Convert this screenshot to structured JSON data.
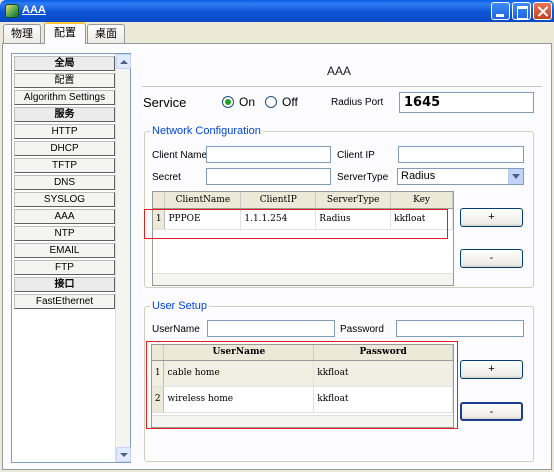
{
  "window": {
    "title": "AAA"
  },
  "tabs": [
    {
      "label": "物理"
    },
    {
      "label": "配置"
    },
    {
      "label": "桌面"
    }
  ],
  "sidebar": {
    "items": [
      {
        "label": "全局",
        "header": true
      },
      {
        "label": "配置",
        "header": false
      },
      {
        "label": "Algorithm Settings",
        "header": false
      },
      {
        "label": "服务",
        "header": true
      },
      {
        "label": "HTTP",
        "header": false
      },
      {
        "label": "DHCP",
        "header": false
      },
      {
        "label": "TFTP",
        "header": false
      },
      {
        "label": "DNS",
        "header": false
      },
      {
        "label": "SYSLOG",
        "header": false
      },
      {
        "label": "AAA",
        "header": false
      },
      {
        "label": "NTP",
        "header": false
      },
      {
        "label": "EMAIL",
        "header": false
      },
      {
        "label": "FTP",
        "header": false
      },
      {
        "label": "接口",
        "header": true
      },
      {
        "label": "FastEthernet",
        "header": false
      }
    ]
  },
  "main": {
    "section_title": "AAA",
    "service": {
      "label": "Service",
      "on_label": "On",
      "off_label": "Off",
      "selected": "On",
      "radius_port_label": "Radius Port",
      "radius_port_value": "1645"
    },
    "network": {
      "title": "Network Configuration",
      "client_name_label": "Client Name",
      "client_name_value": "",
      "client_ip_label": "Client IP",
      "client_ip_value": "",
      "secret_label": "Secret",
      "secret_value": "",
      "server_type_label": "ServerType",
      "server_type_value": "Radius",
      "columns": [
        "ClientName",
        "ClientIP",
        "ServerType",
        "Key"
      ],
      "rows": [
        {
          "num": "1",
          "cells": [
            "PPPOE",
            "1.1.1.254",
            "Radius",
            "kkfloat"
          ]
        }
      ],
      "add_label": "+",
      "remove_label": "-"
    },
    "user": {
      "title": "User Setup",
      "username_label": "UserName",
      "username_value": "",
      "password_label": "Password",
      "password_value": "",
      "columns": [
        "UserName",
        "Password"
      ],
      "rows": [
        {
          "num": "1",
          "cells": [
            "cable home",
            "kkfloat"
          ]
        },
        {
          "num": "2",
          "cells": [
            "wireless home",
            "kkfloat"
          ]
        }
      ],
      "add_label": "+",
      "remove_label": "-"
    }
  },
  "colors": {
    "titlebar": "#0a49c4",
    "group_title": "#0046d5",
    "highlight_box": "#e02020",
    "radio_checked": "#21a121"
  }
}
